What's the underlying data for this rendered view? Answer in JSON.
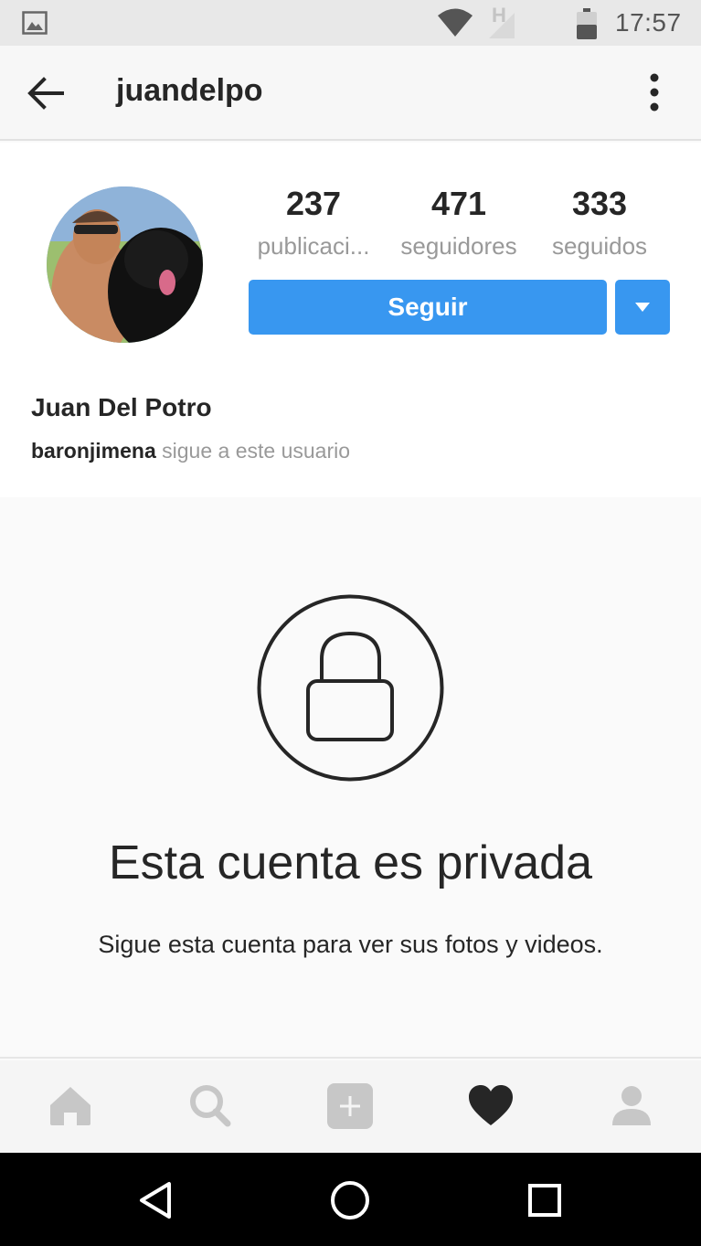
{
  "status_bar": {
    "time": "17:57",
    "network_type": "H",
    "icons": [
      "image-icon",
      "wifi-icon",
      "signal-icon",
      "battery-icon"
    ]
  },
  "app_bar": {
    "title": "juandelpo",
    "back_icon": "arrow-left-icon",
    "menu_icon": "more-vertical-icon"
  },
  "profile": {
    "stats": [
      {
        "value": "237",
        "label": "publicaci..."
      },
      {
        "value": "471",
        "label": "seguidores"
      },
      {
        "value": "333",
        "label": "seguidos"
      }
    ],
    "follow_label": "Seguir",
    "full_name": "Juan Del Potro",
    "followed_by_user": "baronjimena",
    "followed_by_text": " sigue a este usuario"
  },
  "private_notice": {
    "title": "Esta cuenta es privada",
    "subtitle": "Sigue esta cuenta para ver sus fotos y videos."
  },
  "bottom_nav": {
    "items": [
      "home-icon",
      "search-icon",
      "add-post-icon",
      "activity-heart-icon",
      "profile-icon"
    ],
    "active": "activity-heart-icon"
  },
  "colors": {
    "accent": "#3897f0",
    "text": "#262626",
    "muted": "#999999"
  }
}
